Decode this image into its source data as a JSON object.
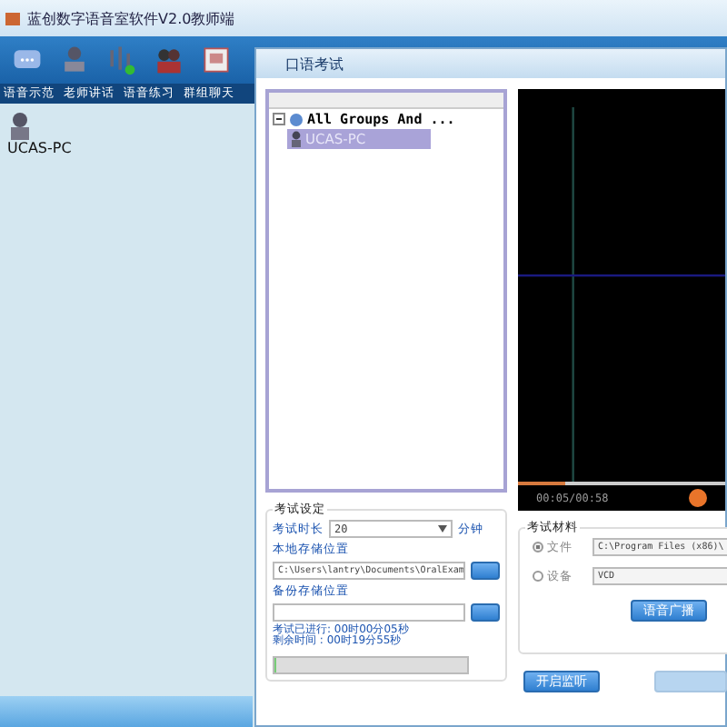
{
  "app": {
    "title": "蓝创数字语音室软件V2.0教师端",
    "toolbar": [
      {
        "label": "语音示范"
      },
      {
        "label": "老师讲话"
      },
      {
        "label": "语音练习"
      },
      {
        "label": "群组聊天"
      }
    ],
    "students": [
      {
        "name": "UCAS-PC"
      }
    ]
  },
  "dialog": {
    "title": "口语考试",
    "tree": {
      "label": "All Groups And ...",
      "expanded": true,
      "children": [
        {
          "label": "UCAS-PC",
          "selected": true
        }
      ]
    },
    "player": {
      "time": "00:05/00:58",
      "level": 0.23
    },
    "settings": {
      "title": "考试设定",
      "duration_label": "考试时长",
      "duration": "20",
      "duration_unit": "分钟",
      "local_label": "本地存储位置",
      "local_path": "C:\\Users\\lantry\\Documents\\OralExam",
      "backup_label": "备份存储位置",
      "elapsed": "考试已进行: 00时00分05秒",
      "remaining": "剩余时间  : 00时19分55秒",
      "level": 0.01
    },
    "material": {
      "title": "考试材料",
      "sources": [
        {
          "label": "文件",
          "value": "C:\\Program Files (x86)\\",
          "selected": true
        },
        {
          "label": "设备",
          "value": "VCD",
          "selected": false
        }
      ],
      "broadcast": "语音广播"
    },
    "buttons": [
      {
        "label": "开启监听",
        "disabled": false
      },
      {
        "disabled": true
      }
    ]
  }
}
